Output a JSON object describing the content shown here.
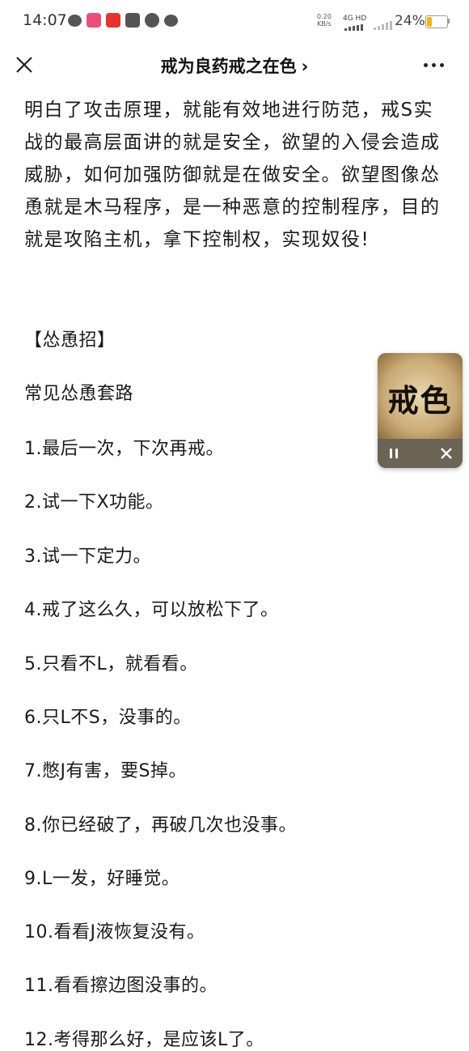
{
  "status_bar": {
    "time": "14:07",
    "net_speed_value": "0.20",
    "net_speed_unit": "KB/s",
    "network": "4G HD",
    "battery_percent": "24%",
    "battery_level": 0.24,
    "battery_color": "#f0b800"
  },
  "nav": {
    "title": "戒为良药戒之在色",
    "title_chevron": "›",
    "close_icon": "close-icon",
    "more_icon": "more-icon"
  },
  "article": {
    "intro_paragraph": "明白了攻击原理，就能有效地进行防范，戒S实战的最高层面讲的就是安全，欲望的入侵会造成威胁，如何加强防御就是在做安全。欲望图像怂恿就是木马程序，是一种恶意的控制程序，目的就是攻陷主机，拿下控制权，实现奴役!",
    "section_heading": "【怂恿招】",
    "subheading": "常见怂恿套路",
    "items": [
      "1.最后一次，下次再戒。",
      "2.试一下X功能。",
      "3.试一下定力。",
      "4.戒了这么久，可以放松下了。",
      "5.只看不L，就看看。",
      "6.只L不S，没事的。",
      "7.憋J有害，要S掉。",
      "8.你已经破了，再破几次也没事。",
      "9.L一发，好睡觉。",
      "10.看看J液恢复没有。",
      "11.看看擦边图没事的。",
      "12.考得那么好，是应该L了。"
    ]
  },
  "floating_player": {
    "cover_text": "戒色",
    "pause_icon": "pause-icon",
    "close_icon": "close-icon"
  }
}
